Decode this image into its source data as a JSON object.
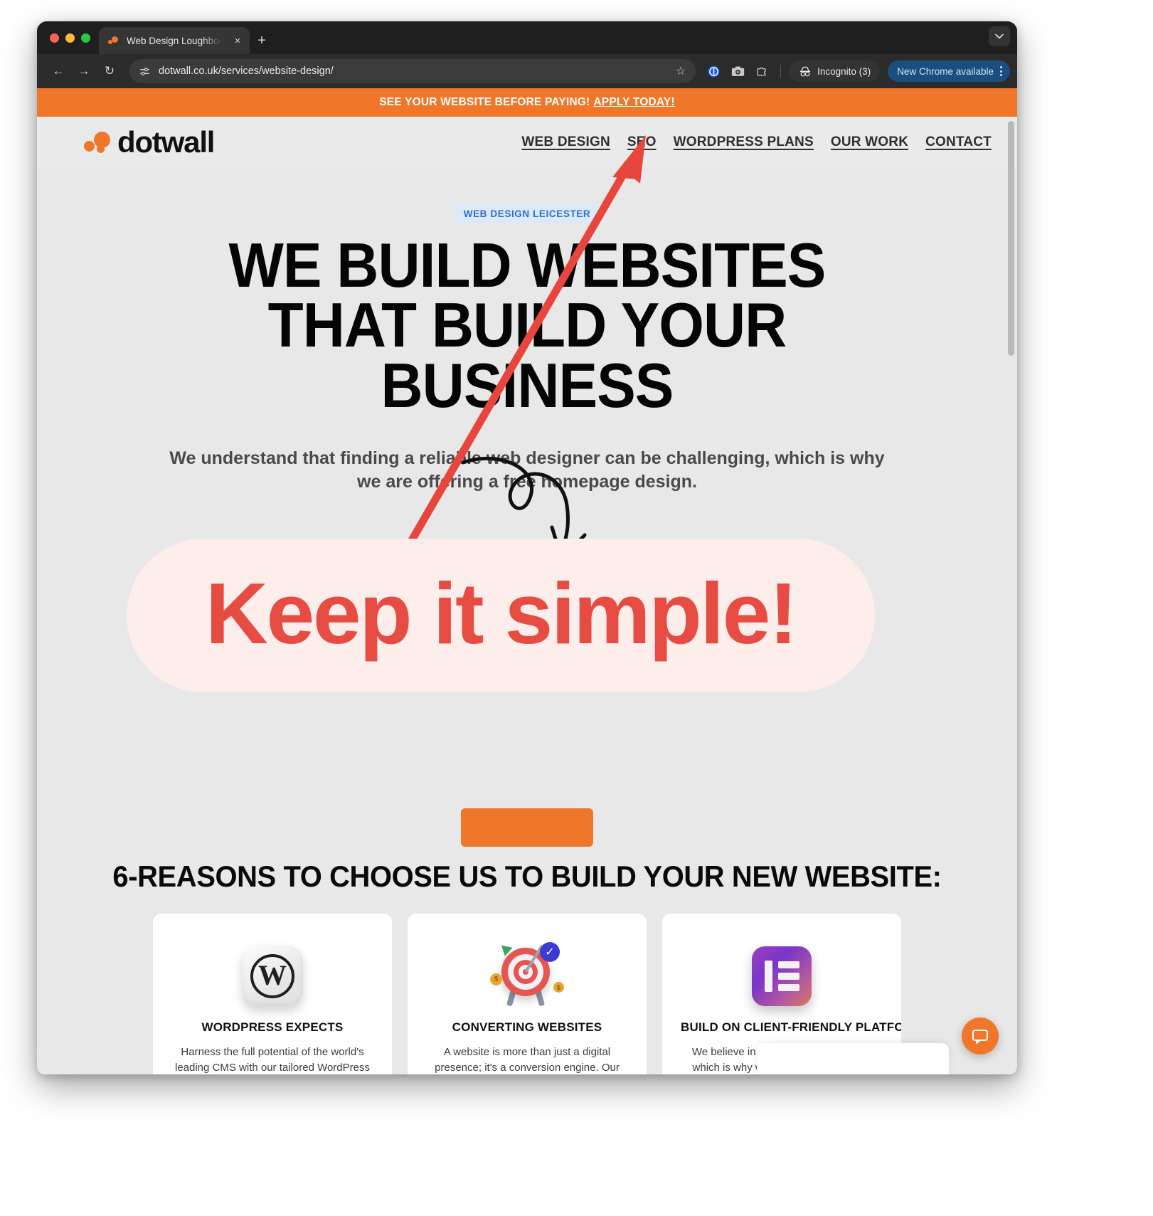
{
  "browser": {
    "tab": {
      "title": "Web Design Loughboough an",
      "close_label": "×",
      "favicon": "dotwall-favicon"
    },
    "new_tab_label": "+",
    "tab_list_chevron": "⌄",
    "nav": {
      "back": "←",
      "forward": "→",
      "reload": "↻"
    },
    "omnibox": {
      "url": "dotwall.co.uk/services/website-design/",
      "site_info_icon": "tune-icon",
      "star": "☆"
    },
    "toolbar_icons": [
      "onepassword-icon",
      "camera-icon",
      "extensions-icon"
    ],
    "incognito_label": "Incognito (3)",
    "update_label": "New Chrome available",
    "update_menu": "kebab-icon"
  },
  "site": {
    "announcement": {
      "text": "SEE YOUR WEBSITE BEFORE PAYING!",
      "link": "APPLY TODAY!"
    },
    "logo_word": "dotwall",
    "nav_items": [
      {
        "label": "WEB DESIGN"
      },
      {
        "label": "SEO"
      },
      {
        "label": "WORDPRESS PLANS"
      },
      {
        "label": "OUR WORK"
      },
      {
        "label": "CONTACT"
      }
    ],
    "hero": {
      "badge": "WEB DESIGN LEICESTER",
      "headline": "WE BUILD WEBSITES THAT BUILD YOUR BUSINESS",
      "subtext": "We understand that finding a reliable web designer can be challenging, which is why we are offering a free homepage design."
    },
    "reasons_heading": "6-REASONS TO CHOOSE US TO BUILD YOUR NEW WEBSITE:",
    "cards": [
      {
        "icon": "wordpress-icon",
        "title": "WORDPRESS EXPECTS",
        "body": "Harness the full potential of the world's leading CMS with our tailored WordPress solutions. Our expertise ensures your site"
      },
      {
        "icon": "target-dart-icon",
        "title": "CONVERTING WEBSITES",
        "body": "A website is more than just a digital presence; it's a conversion engine. Our design philosophy focuses on guiding"
      },
      {
        "icon": "elementor-icon",
        "title": "BUILD ON CLIENT-FRIENDLY PLATFORMS",
        "body": "We believe in empowering our clients, which is why we build on user-friendly platforms. With an intuitive interface and"
      }
    ],
    "chat_icon": "chat-bubble-icon"
  },
  "annotation": {
    "callout_text": "Keep it simple!",
    "arrow_color": "#e8463c",
    "callout_bg": "#fdeeec",
    "callout_color": "#e74c43"
  },
  "colors": {
    "brand_orange": "#f0762a",
    "page_bg": "#e8e8e8",
    "accent_blue": "#2f6fd0"
  }
}
